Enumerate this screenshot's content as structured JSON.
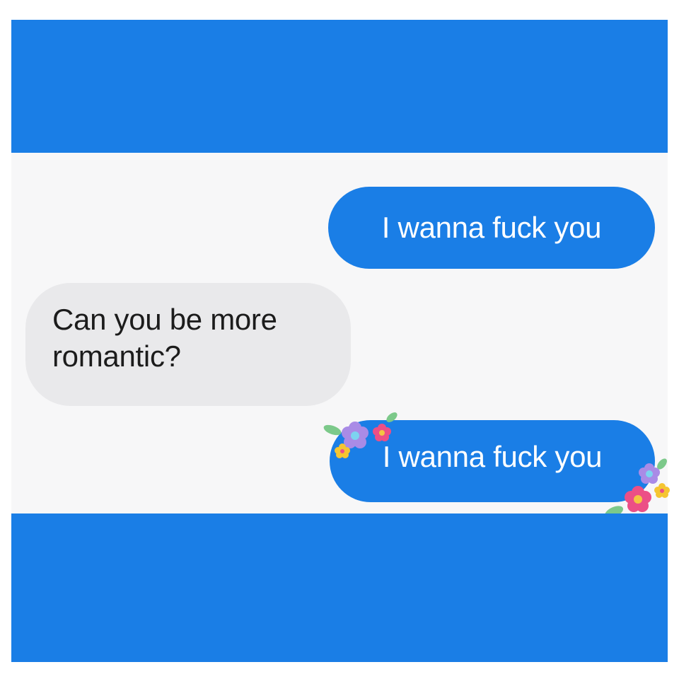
{
  "conversation": {
    "messages": [
      {
        "sender": "me",
        "text": "I wanna fuck you"
      },
      {
        "sender": "them",
        "text": "Can you be more romantic?"
      },
      {
        "sender": "me",
        "text": "I wanna fuck you",
        "decoration": "flower-stickers"
      }
    ]
  },
  "colors": {
    "accent": "#1a7ee6",
    "incoming_bubble": "#e9e9eb",
    "chat_background": "#f7f7f8"
  },
  "icons": [
    "flower-cluster-icon"
  ]
}
